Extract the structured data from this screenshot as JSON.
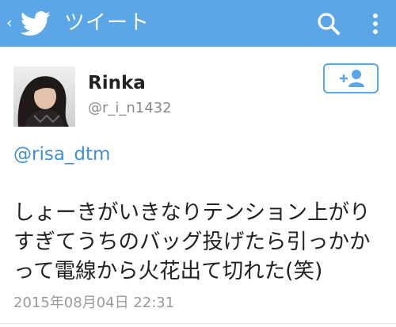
{
  "header": {
    "title": "ツイート",
    "back_icon": "chevron-left-icon",
    "logo_icon": "twitter-bird-icon",
    "search_icon": "search-icon",
    "more_icon": "more-vertical-icon",
    "bar_color": "#5aa6e6"
  },
  "tweet": {
    "author_name": "Rinka",
    "author_handle": "@r_i_n1432",
    "follow_icon": "add-user-icon",
    "mention": "@risa_dtm",
    "text": "しょーきがいきなりテンション上がりすぎてうちのバッグ投げたら引っかかって電線から火花出て切れた(笑)",
    "timestamp": "2015年08月04日 22:31",
    "link_color": "#3f8fd3"
  }
}
